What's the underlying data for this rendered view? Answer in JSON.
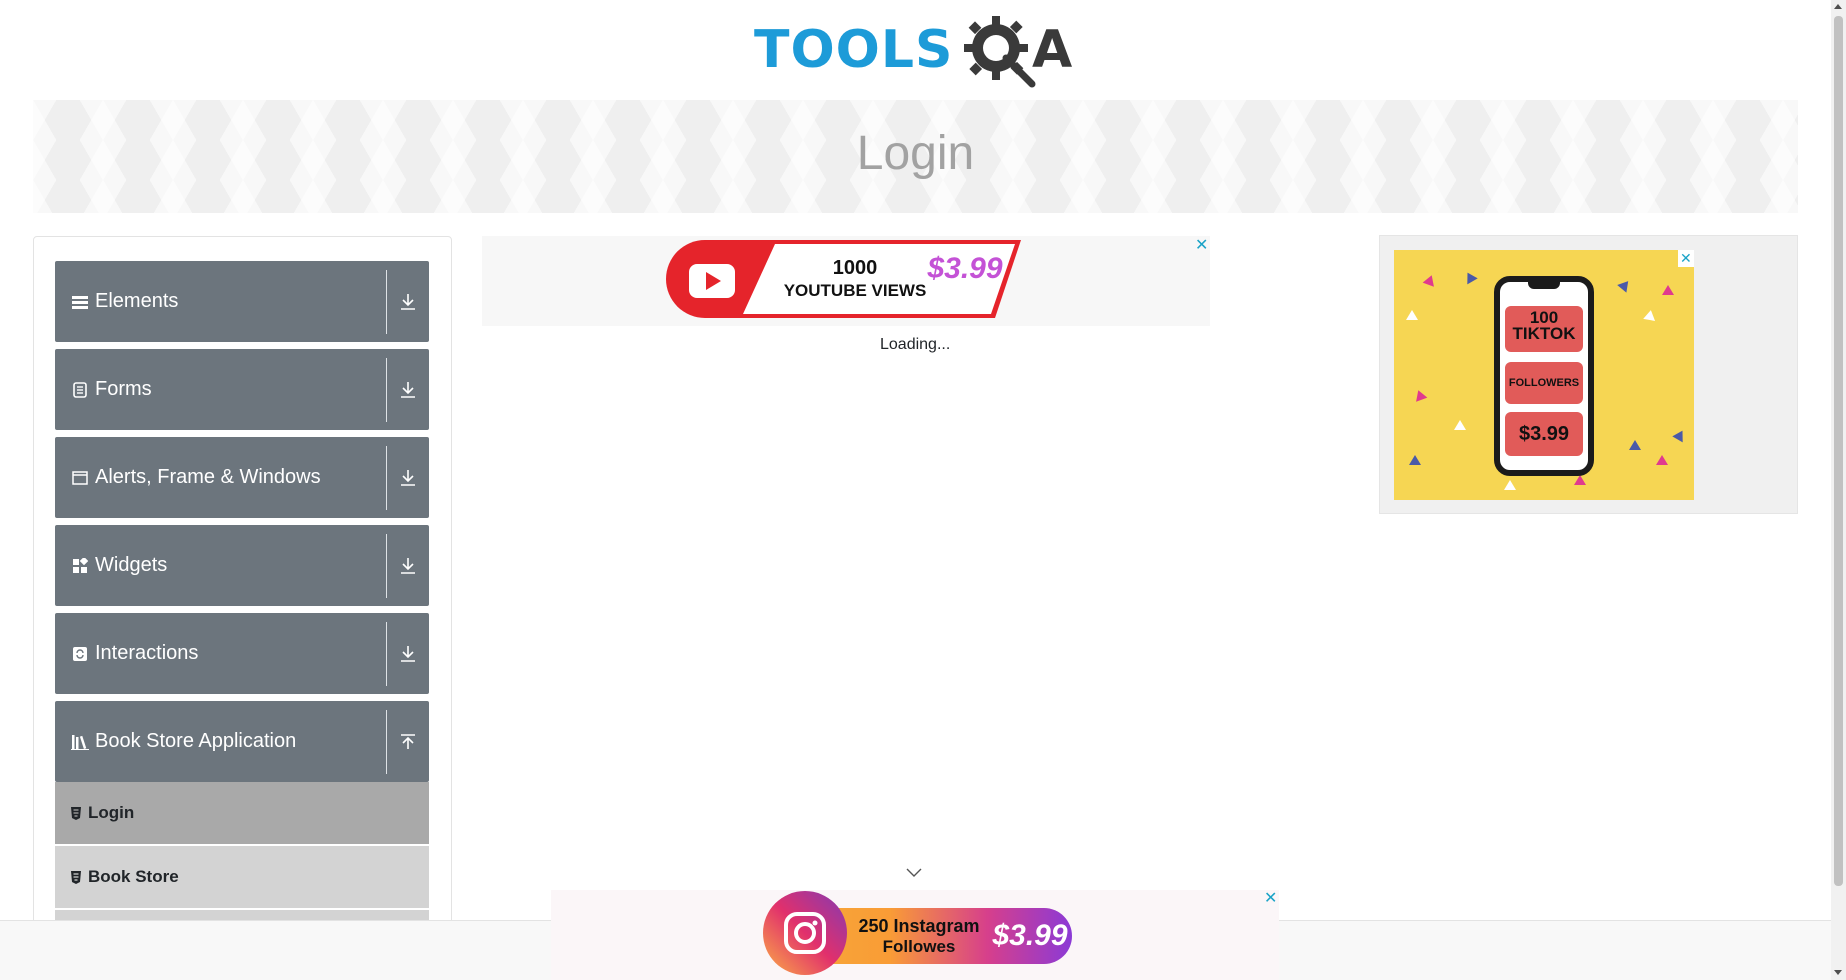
{
  "logo": {
    "text": "TOOLS",
    "suffix": "A"
  },
  "banner": {
    "title": "Login"
  },
  "sidebar": {
    "groups": [
      {
        "label": "Elements",
        "icon": "hamburger-icon",
        "arrow": "download-arrow-icon"
      },
      {
        "label": "Forms",
        "icon": "form-icon",
        "arrow": "download-arrow-icon"
      },
      {
        "label": "Alerts, Frame & Windows",
        "icon": "window-icon",
        "arrow": "download-arrow-icon"
      },
      {
        "label": "Widgets",
        "icon": "widgets-icon",
        "arrow": "download-arrow-icon"
      },
      {
        "label": "Interactions",
        "icon": "interactions-icon",
        "arrow": "download-arrow-icon"
      },
      {
        "label": "Book Store Application",
        "icon": "books-icon",
        "arrow": "upload-arrow-icon"
      }
    ],
    "subitems": [
      {
        "label": "Login",
        "active": true
      },
      {
        "label": "Book Store",
        "active": false
      }
    ]
  },
  "ads": {
    "top": {
      "line1": "1000",
      "line2": "YOUTUBE VIEWS",
      "price": "$3.99",
      "close": "✕"
    },
    "right": {
      "line1": "100",
      "line2": "TIKTOK",
      "line3": "FOLLOWERS",
      "price": "$3.99",
      "close": "✕"
    },
    "bottom": {
      "line1": "250 Instagram",
      "line2": "Followes",
      "price": "$3.99",
      "close": "✕"
    }
  },
  "main": {
    "status": "Loading..."
  },
  "colors": {
    "sidebar_group": "#6c757d",
    "active_item": "#a9a9a9",
    "brand_blue": "#1d9bd8"
  }
}
